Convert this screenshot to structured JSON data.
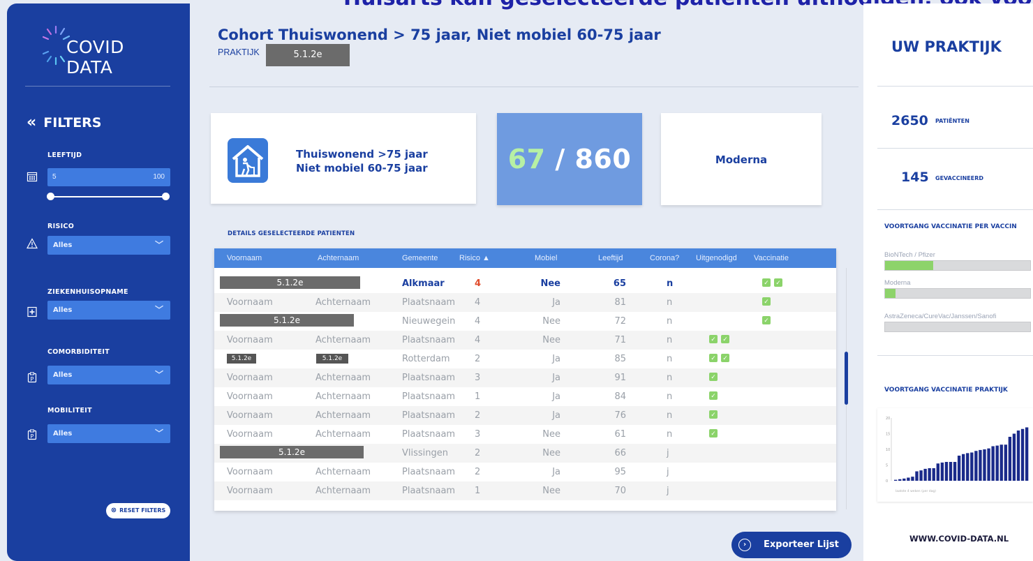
{
  "banner": {
    "text": "Huisarts kan geselecteerde patiënten uitnodigen, ook voor Co"
  },
  "sidebar": {
    "logo_text": "COVID DATA",
    "filters_title": "FILTERS",
    "collapse_icon": "double-chevron-left-icon",
    "leeftijd": {
      "label": "LEEFTIJD",
      "min": "5",
      "max": "100",
      "icon": "calendar-icon"
    },
    "risico": {
      "label": "RISICO",
      "value": "Alles",
      "icon": "warning-triangle-icon"
    },
    "ziekenhuis": {
      "label": "ZIEKENHUISOPNAME",
      "value": "Alles",
      "icon": "hospital-cross-icon"
    },
    "comorbiditeit": {
      "label": "COMORBIDITEIT",
      "value": "Alles",
      "icon": "parking-clipboard-icon"
    },
    "mobiliteit": {
      "label": "MOBILITEIT",
      "value": "Alles",
      "icon": "parking-clipboard-icon"
    },
    "reset_label": "RESET FILTERS"
  },
  "header": {
    "title": "Cohort Thuiswonend > 75 jaar, Niet mobiel 60-75 jaar",
    "praktijk_label": "PRAKTIJK",
    "praktijk_redaction": "5.1.2e"
  },
  "cohort_card": {
    "line1": "Thuiswonend >75 jaar",
    "line2": "Niet mobiel 60-75 jaar"
  },
  "count_card": {
    "done": "67",
    "separator": " / ",
    "total": "860"
  },
  "vaccine_card": {
    "name": "Moderna"
  },
  "details": {
    "label": "DETAILS GESELECTEERDE PATIENTEN",
    "columns": [
      "Voornaam",
      "Achternaam",
      "Gemeente",
      "Risico ▲",
      "Mobiel",
      "Leeftijd",
      "Corona?",
      "Uitgenodigd",
      "Vaccinatie"
    ],
    "rows": [
      {
        "redact": "5.1.2e",
        "gemeente": "Alkmaar",
        "risico": "4",
        "mobiel": "Nee",
        "leeftijd": "65",
        "corona": "n",
        "uitgenodigd": 0,
        "vaccinatie": 2,
        "bold": true
      },
      {
        "voornaam": "Voornaam",
        "achternaam": "Achternaam",
        "gemeente": "Plaatsnaam",
        "risico": "4",
        "mobiel": "Ja",
        "leeftijd": "81",
        "corona": "n",
        "uitgenodigd": 0,
        "vaccinatie": 1
      },
      {
        "redact": "5.1.2e",
        "gemeente": "Nieuwegein",
        "risico": "4",
        "mobiel": "Nee",
        "leeftijd": "72",
        "corona": "n",
        "uitgenodigd": 0,
        "vaccinatie": 1
      },
      {
        "voornaam": "Voornaam",
        "achternaam": "Achternaam",
        "gemeente": "Plaatsnaam",
        "risico": "4",
        "mobiel": "Nee",
        "leeftijd": "71",
        "corona": "n",
        "uitgenodigd": 2,
        "vaccinatie": 0
      },
      {
        "redact_small": [
          "5.1.2e",
          "5.1.2e"
        ],
        "gemeente": "Rotterdam",
        "risico": "2",
        "mobiel": "Ja",
        "leeftijd": "85",
        "corona": "n",
        "uitgenodigd": 2,
        "vaccinatie": 0
      },
      {
        "voornaam": "Voornaam",
        "achternaam": "Achternaam",
        "gemeente": "Plaatsnaam",
        "risico": "3",
        "mobiel": "Ja",
        "leeftijd": "91",
        "corona": "n",
        "uitgenodigd": 1,
        "vaccinatie": 0
      },
      {
        "voornaam": "Voornaam",
        "achternaam": "Achternaam",
        "gemeente": "Plaatsnaam",
        "risico": "1",
        "mobiel": "Ja",
        "leeftijd": "84",
        "corona": "n",
        "uitgenodigd": 1,
        "vaccinatie": 0
      },
      {
        "voornaam": "Voornaam",
        "achternaam": "Achternaam",
        "gemeente": "Plaatsnaam",
        "risico": "2",
        "mobiel": "Ja",
        "leeftijd": "76",
        "corona": "n",
        "uitgenodigd": 1,
        "vaccinatie": 0
      },
      {
        "voornaam": "Voornaam",
        "achternaam": "Achternaam",
        "gemeente": "Plaatsnaam",
        "risico": "3",
        "mobiel": "Nee",
        "leeftijd": "61",
        "corona": "n",
        "uitgenodigd": 1,
        "vaccinatie": 0
      },
      {
        "redact": "5.1.2e",
        "gemeente": "Vlissingen",
        "risico": "2",
        "mobiel": "Nee",
        "leeftijd": "66",
        "corona": "j",
        "uitgenodigd": 0,
        "vaccinatie": 0
      },
      {
        "voornaam": "Voornaam",
        "achternaam": "Achternaam",
        "gemeente": "Plaatsnaam",
        "risico": "2",
        "mobiel": "Ja",
        "leeftijd": "95",
        "corona": "j",
        "uitgenodigd": 0,
        "vaccinatie": 0
      },
      {
        "voornaam": "Voornaam",
        "achternaam": "Achternaam",
        "gemeente": "Plaatsnaam",
        "risico": "1",
        "mobiel": "Nee",
        "leeftijd": "70",
        "corona": "j",
        "uitgenodigd": 0,
        "vaccinatie": 0
      }
    ],
    "export_label": "Exporteer Lijst"
  },
  "right_panel": {
    "title": "UW PRAKTIJK",
    "patients_num": "2650",
    "patients_label": "PATIËNTEN",
    "vaccinated_num": "145",
    "vaccinated_label": "GEVACCINEERD",
    "per_vaccine_title": "VOORTGANG VACCINATIE PER VACCIN",
    "vaccines": [
      {
        "name": "BioNTech / Pfizer",
        "progress": 0.33
      },
      {
        "name": "Moderna",
        "progress": 0.07
      },
      {
        "name": "AstraZeneca/CureVac/Janssen/Sanofi",
        "progress": 0.0
      }
    ],
    "praktijk_title": "VOORTGANG VACCINATIE PRAKTIJK",
    "website": "WWW.COVID-DATA.NL"
  },
  "chart_data": {
    "type": "bar",
    "y_ticks": [
      "20",
      "15",
      "10",
      "5",
      "0"
    ],
    "ylim": [
      0,
      20
    ],
    "xlabel": "laatste 4 weken (per dag)",
    "values": [
      0.3,
      0.5,
      0.7,
      1,
      1.3,
      3,
      3.3,
      3.8,
      4,
      4,
      5.5,
      5.8,
      6,
      6,
      6,
      8,
      8.5,
      8.8,
      9,
      9.5,
      9.8,
      10,
      10.3,
      11,
      11.2,
      11.5,
      11.5,
      14,
      15,
      16,
      16.5,
      17
    ]
  },
  "colors": {
    "sidebar": "#1a3fa0",
    "accent": "#3f7be0",
    "table_header": "#4a86dd",
    "count_card": "#6f9be0",
    "check_green": "#8bd36a",
    "risk_red": "#e04c2c"
  }
}
